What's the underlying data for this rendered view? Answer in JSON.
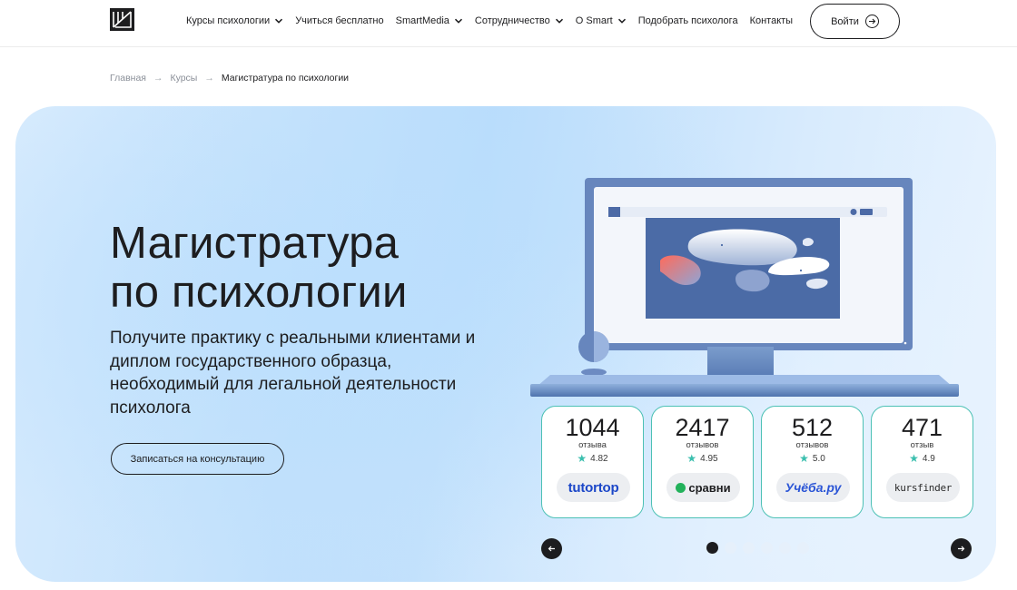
{
  "header": {
    "nav": [
      {
        "label": "Курсы психологии",
        "has_dropdown": true
      },
      {
        "label": "Учиться бесплатно",
        "has_dropdown": false
      },
      {
        "label": "SmartMedia",
        "has_dropdown": true
      },
      {
        "label": "Сотрудничество",
        "has_dropdown": true
      },
      {
        "label": "О Smart",
        "has_dropdown": true
      },
      {
        "label": "Подобрать психолога",
        "has_dropdown": false
      },
      {
        "label": "Контакты",
        "has_dropdown": false
      }
    ],
    "login_label": "Войти"
  },
  "breadcrumb": {
    "items": [
      "Главная",
      "Курсы"
    ],
    "current": "Магистратура по психологии",
    "separator": "→"
  },
  "hero": {
    "title_line1": "Магистратура",
    "title_line2": "по психологии",
    "subtitle": "Получите практику с реальными клиентами и диплом государственного образца, необходимый для легальной деятельности психолога",
    "cta_label": "Записаться на консультацию"
  },
  "reviews": [
    {
      "count": "1044",
      "label": "отзыва",
      "rating": "4.82",
      "brand": "tutortop"
    },
    {
      "count": "2417",
      "label": "отзывов",
      "rating": "4.95",
      "brand": "сравни"
    },
    {
      "count": "512",
      "label": "отзывов",
      "rating": "5.0",
      "brand": "Учёба.ру"
    },
    {
      "count": "471",
      "label": "отзыв",
      "rating": "4.9",
      "brand": "kursfinder"
    }
  ],
  "slider": {
    "total": 6,
    "active": 0
  },
  "colors": {
    "accent_teal": "#4cc1b5",
    "dark": "#1d1d1f",
    "tutortop": "#1c47c8",
    "sravni_green": "#23b25b",
    "ucheba": "#2c56d6"
  }
}
